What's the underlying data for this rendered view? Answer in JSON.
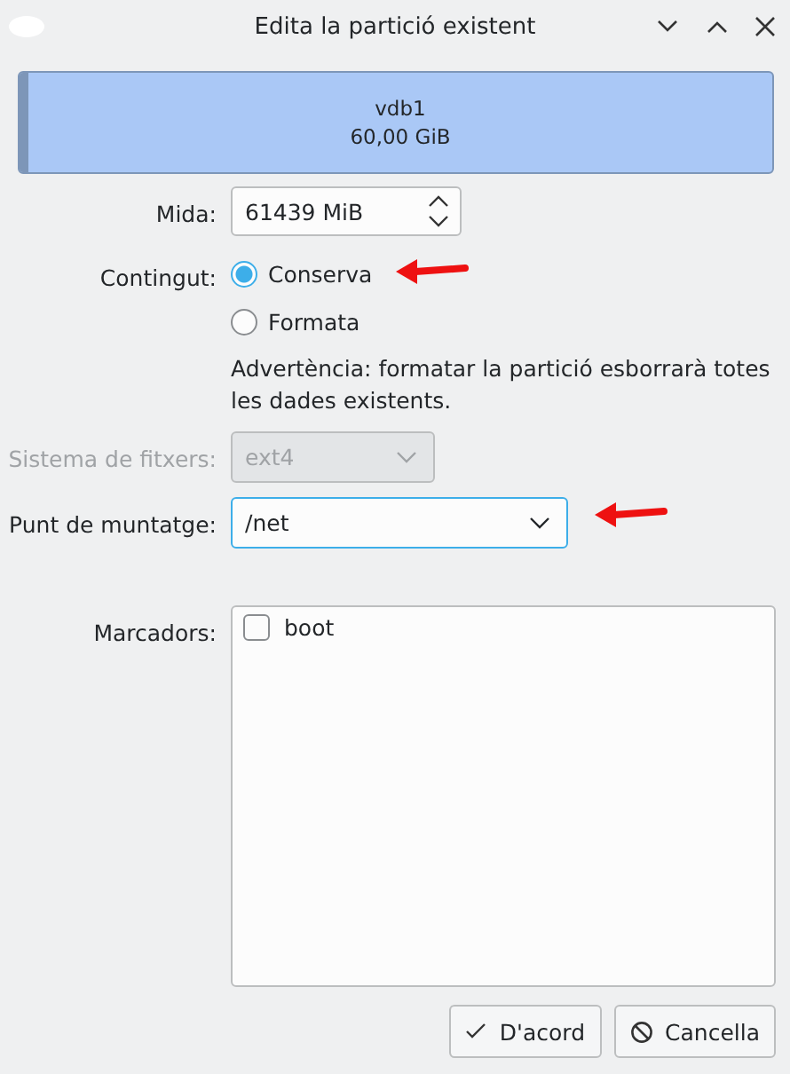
{
  "window": {
    "title": "Edita la partició existent"
  },
  "partition": {
    "name": "vdb1",
    "size": "60,00 GiB"
  },
  "size": {
    "label": "Mida:",
    "value": "61439 MiB"
  },
  "content": {
    "label": "Contingut:",
    "options": [
      {
        "label": "Conserva",
        "selected": true
      },
      {
        "label": "Formata",
        "selected": false
      }
    ]
  },
  "warning": "Advertència: formatar la partició esborrarà totes les dades existents.",
  "filesystem": {
    "label": "Sistema de fitxers:",
    "value": "ext4",
    "disabled": true
  },
  "mount_point": {
    "label": "Punt de muntatge:",
    "value": "/net",
    "disabled": false
  },
  "flags": {
    "label": "Marcadors:",
    "items": [
      {
        "label": "boot",
        "checked": false
      }
    ]
  },
  "buttons": [
    {
      "label": "D'acord",
      "kind": "ok"
    },
    {
      "label": "Cancella",
      "kind": "cancel"
    }
  ]
}
